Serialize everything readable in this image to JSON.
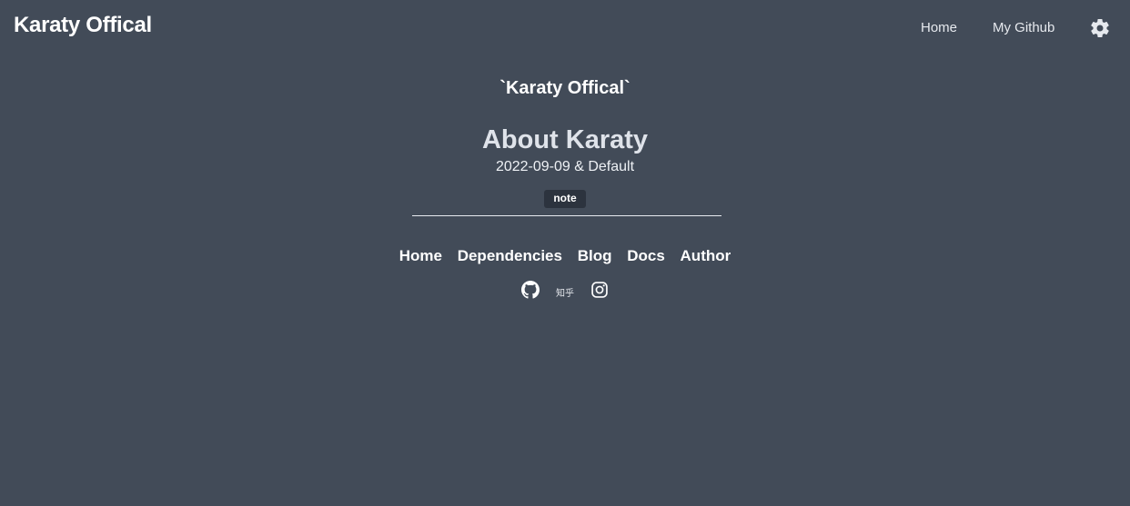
{
  "navbar": {
    "brand": "Karaty Offical",
    "links": [
      {
        "label": "Home"
      },
      {
        "label": "My Github"
      }
    ],
    "theme_icon": "gear-icon"
  },
  "post": {
    "site_tag": "`Karaty Offical`",
    "title": "About Karaty",
    "meta": "2022-09-09 & Default",
    "tag": "note"
  },
  "footer": {
    "links": [
      {
        "label": "Home"
      },
      {
        "label": "Dependencies"
      },
      {
        "label": "Blog"
      },
      {
        "label": "Docs"
      },
      {
        "label": "Author"
      }
    ],
    "socials": {
      "github_icon": "github-icon",
      "zhihu_label": "知乎",
      "instagram_icon": "instagram-icon"
    }
  },
  "colors": {
    "background": "#424b58",
    "tag_background": "#2c333e",
    "text": "#ffffff"
  }
}
